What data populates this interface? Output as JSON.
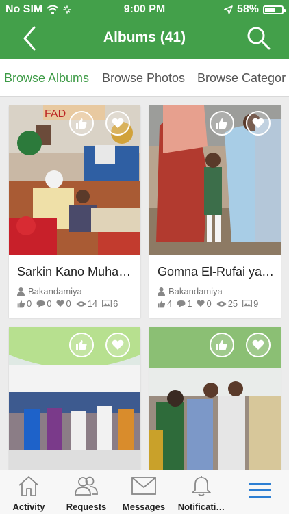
{
  "status_bar": {
    "carrier": "No SIM",
    "time": "9:00 PM",
    "battery_text": "58%",
    "battery_level": 0.58
  },
  "header": {
    "title": "Albums (41)",
    "back_icon": "chevron-left-icon",
    "search_icon": "search-icon",
    "background": "#43a04a"
  },
  "tabs": [
    {
      "label": "Browse Albums",
      "active": true
    },
    {
      "label": "Browse Photos",
      "active": false
    },
    {
      "label": "Browse Categor",
      "active": false
    }
  ],
  "albums": [
    {
      "title": "Sarkin Kano Muha…",
      "author": "Bakandamiya",
      "likes": "0",
      "comments": "0",
      "favorites": "0",
      "views": "14",
      "photos": "6"
    },
    {
      "title": "Gomna El-Rufai ya…",
      "author": "Bakandamiya",
      "likes": "4",
      "comments": "1",
      "favorites": "0",
      "views": "25",
      "photos": "9"
    },
    {
      "title": "",
      "author": "",
      "likes": "",
      "comments": "",
      "favorites": "",
      "views": "",
      "photos": ""
    },
    {
      "title": "",
      "author": "",
      "likes": "",
      "comments": "",
      "favorites": "",
      "views": "",
      "photos": ""
    }
  ],
  "tabbar": [
    {
      "label": "Activity",
      "icon": "home-icon"
    },
    {
      "label": "Requests",
      "icon": "users-icon"
    },
    {
      "label": "Messages",
      "icon": "envelope-icon"
    },
    {
      "label": "Notificati…",
      "icon": "bell-icon"
    },
    {
      "label": "",
      "icon": "menu-icon"
    }
  ],
  "colors": {
    "accent": "#43a04a",
    "menu_icon": "#2d7fd3"
  }
}
